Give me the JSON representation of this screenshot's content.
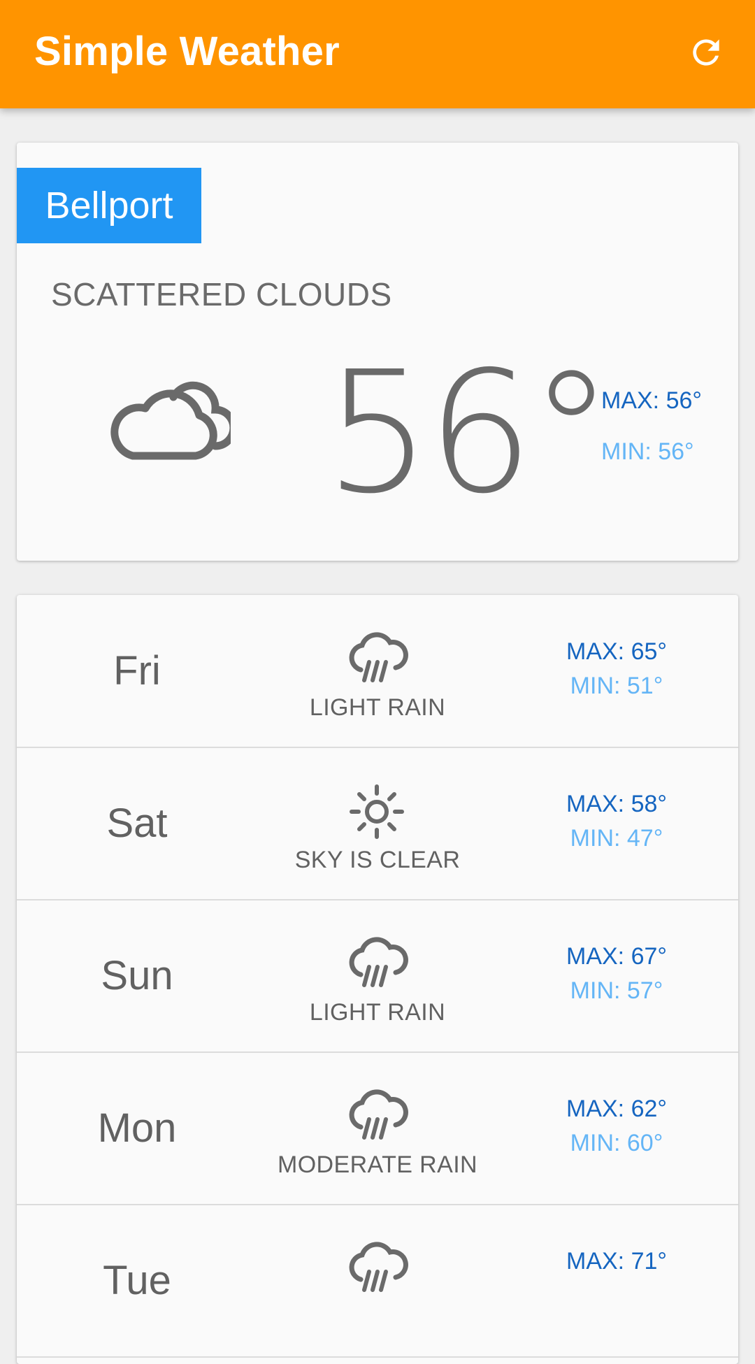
{
  "app": {
    "title": "Simple Weather",
    "refresh_icon": "refresh-icon"
  },
  "colors": {
    "appbar": "#ff9400",
    "city_chip": "#2196f3",
    "max_text": "#1565c0",
    "min_text": "#64b5f6",
    "icon_gray": "#6a6a6a"
  },
  "current": {
    "city": "Bellport",
    "condition": "SCATTERED CLOUDS",
    "icon": "cloud-icon",
    "temperature": "56°",
    "max": "MAX: 56°",
    "min": "MIN: 56°"
  },
  "forecast": [
    {
      "day": "Fri",
      "icon": "rain-icon",
      "desc": "LIGHT RAIN",
      "max": "MAX: 65°",
      "min": "MIN: 51°"
    },
    {
      "day": "Sat",
      "icon": "sun-icon",
      "desc": "SKY IS CLEAR",
      "max": "MAX: 58°",
      "min": "MIN: 47°"
    },
    {
      "day": "Sun",
      "icon": "rain-icon",
      "desc": "LIGHT RAIN",
      "max": "MAX: 67°",
      "min": "MIN: 57°"
    },
    {
      "day": "Mon",
      "icon": "rain-icon",
      "desc": "MODERATE RAIN",
      "max": "MAX: 62°",
      "min": "MIN: 60°"
    },
    {
      "day": "Tue",
      "icon": "rain-icon",
      "desc": "",
      "max": "MAX: 71°",
      "min": ""
    }
  ]
}
